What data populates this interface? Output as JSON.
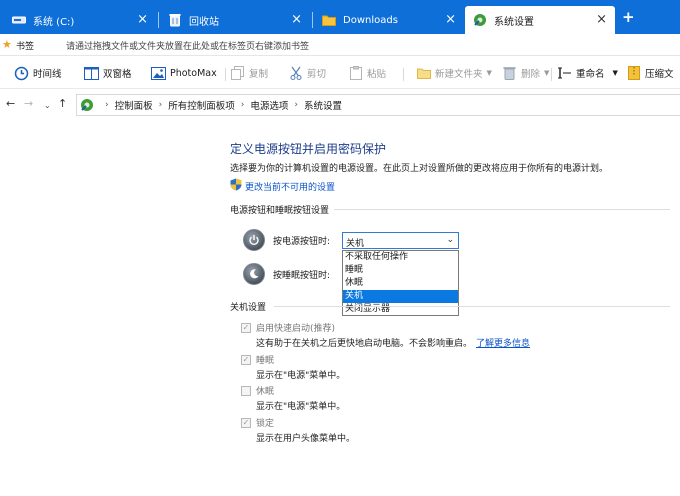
{
  "tabs": [
    {
      "title": "系统 (C:)",
      "icon": "drive-icon"
    },
    {
      "title": "回收站",
      "icon": "recycle-bin-icon"
    },
    {
      "title": "Downloads",
      "icon": "folder-icon"
    },
    {
      "title": "系统设置",
      "icon": "control-panel-icon",
      "active": true
    }
  ],
  "new_tab_label": "+",
  "bookmarks": {
    "label": "书签",
    "hint": "请通过拖拽文件或文件夹放置在此处或在标签页右键添加书签"
  },
  "toolbar": {
    "timeline": "时间线",
    "dual_pane": "双窗格",
    "photomax": "PhotoMax",
    "copy": "复制",
    "cut": "剪切",
    "paste": "粘贴",
    "new_folder": "新建文件夹",
    "delete": "删除",
    "rename": "重命名",
    "compress": "压缩文"
  },
  "breadcrumb": [
    "控制面板",
    "所有控制面板项",
    "电源选项",
    "系统设置"
  ],
  "page": {
    "title": "定义电源按钮并启用密码保护",
    "description": "选择要为你的计算机设置的电源设置。在此页上对设置所做的更改将应用于你所有的电源计划。",
    "change_link": "更改当前不可用的设置",
    "section_buttons": "电源按钮和睡眠按钮设置",
    "power_button_label": "按电源按钮时:",
    "sleep_button_label": "按睡眠按钮时:",
    "power_button_value": "关机",
    "dropdown_options": [
      "不采取任何操作",
      "睡眠",
      "休眠",
      "关机",
      "关闭显示器"
    ],
    "dropdown_selected_index": 3,
    "section_shutdown": "关机设置",
    "fast_startup": {
      "label": "启用快速启动(推荐)",
      "checked": true,
      "desc": "这有助于在关机之后更快地启动电脑。不会影响重启。",
      "more": "了解更多信息"
    },
    "sleep": {
      "label": "睡眠",
      "checked": true,
      "desc": "显示在\"电源\"菜单中。"
    },
    "hibernate": {
      "label": "休眠",
      "checked": false,
      "desc": "显示在\"电源\"菜单中。"
    },
    "lock": {
      "label": "锁定",
      "checked": true,
      "desc": "显示在用户头像菜单中。"
    }
  },
  "colors": {
    "tab_bar": "#0f6fd8",
    "heading": "#1e3d8a",
    "link": "#0a53c8",
    "selection": "#0a7ae2"
  }
}
